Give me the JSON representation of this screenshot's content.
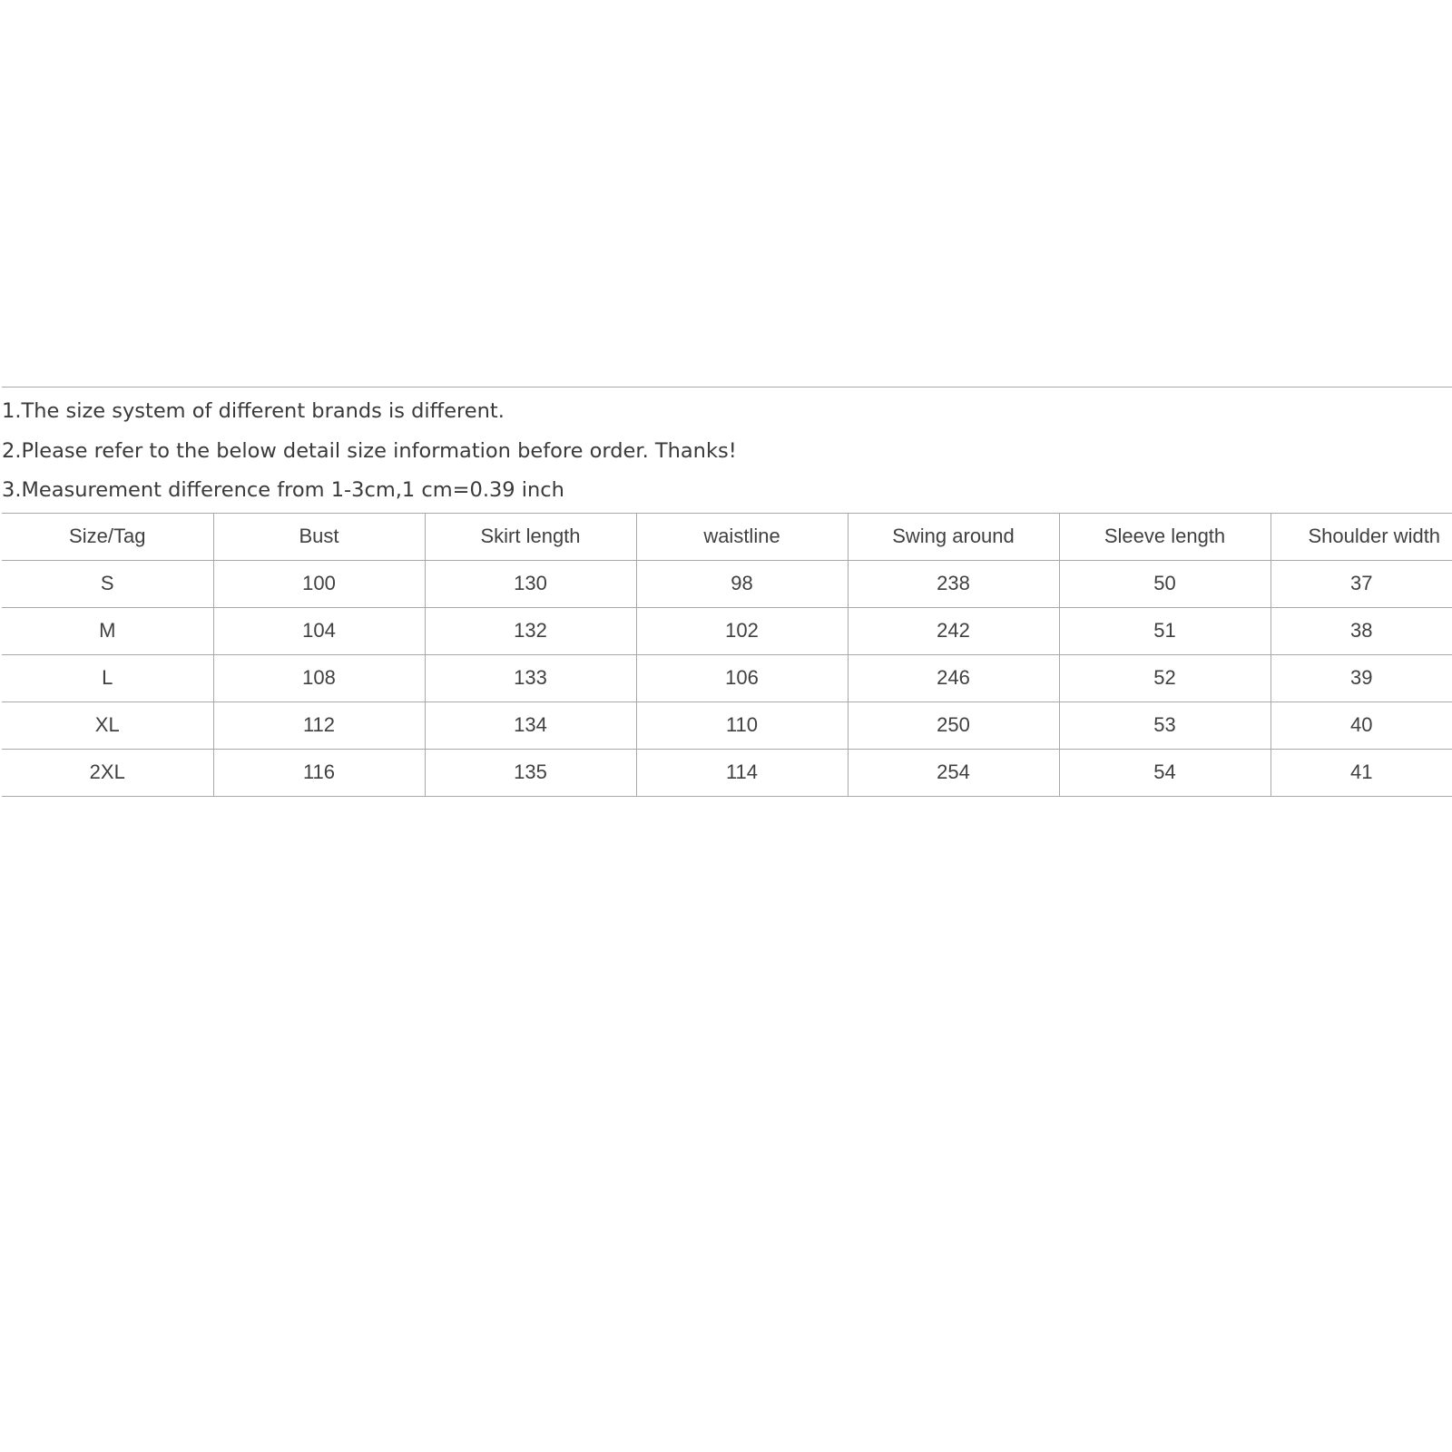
{
  "notes": [
    "1.The size system of different brands is different.",
    "2.Please refer to the below detail size information before order. Thanks!",
    "3.Measurement difference from 1-3cm,1 cm=0.39 inch"
  ],
  "table": {
    "headers": [
      "Size/Tag",
      "Bust",
      "Skirt length",
      "waistline",
      "Swing around",
      "Sleeve length",
      "Shoulder width"
    ],
    "rows": [
      [
        "S",
        "100",
        "130",
        "98",
        "238",
        "50",
        "37"
      ],
      [
        "M",
        "104",
        "132",
        "102",
        "242",
        "51",
        "38"
      ],
      [
        "L",
        "108",
        "133",
        "106",
        "246",
        "52",
        "39"
      ],
      [
        "XL",
        "112",
        "134",
        "110",
        "250",
        "53",
        "40"
      ],
      [
        "2XL",
        "116",
        "135",
        "114",
        "254",
        "54",
        "41"
      ]
    ]
  }
}
